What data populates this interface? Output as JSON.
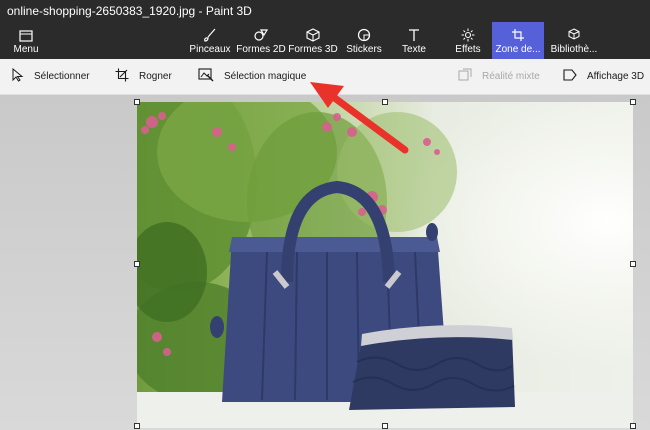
{
  "window": {
    "title": "online-shopping-2650383_1920.jpg - Paint 3D"
  },
  "ribbon": {
    "menu_label": "Menu",
    "tabs": [
      {
        "label": "Pinceaux",
        "icon": "brush-icon"
      },
      {
        "label": "Formes 2D",
        "icon": "shapes-2d-icon"
      },
      {
        "label": "Formes 3D",
        "icon": "cube-icon"
      },
      {
        "label": "Stickers",
        "icon": "sticker-icon"
      },
      {
        "label": "Texte",
        "icon": "text-icon"
      },
      {
        "label": "Effets",
        "icon": "sun-icon"
      },
      {
        "label": "Zone de...",
        "icon": "crop-canvas-icon",
        "active": true
      },
      {
        "label": "Bibliothè...",
        "icon": "library-icon"
      }
    ]
  },
  "toolbar": {
    "select_label": "Sélectionner",
    "crop_label": "Rogner",
    "magic_select_label": "Sélection magique",
    "mixed_reality_label": "Réalité mixte",
    "view_3d_label": "Affichage 3D"
  },
  "colors": {
    "titlebar_bg": "#2b2b2b",
    "active_tab": "#5660d8",
    "toolbar_bg": "#f2f2f2",
    "annotation_arrow": "#e8322a",
    "bag_blue": "#3d4a80"
  }
}
